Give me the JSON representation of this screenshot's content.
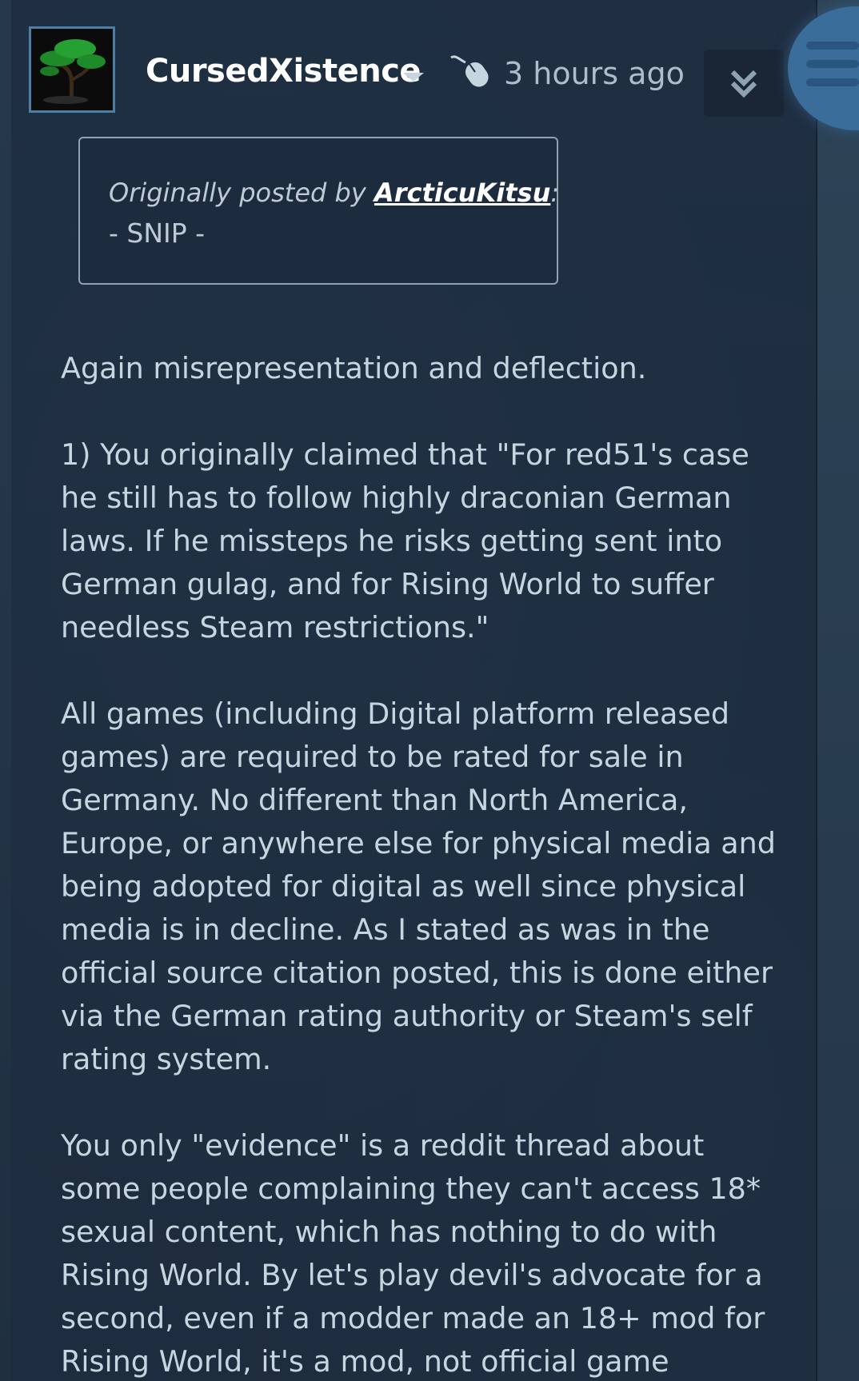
{
  "post": {
    "author": "CursedXistence",
    "timestamp": "3 hours ago",
    "quote": {
      "prefix": "Originally posted by",
      "author": "ArcticuKitsu",
      "suffix": ":",
      "text": "- SNIP -"
    },
    "paragraphs": [
      [
        "Again misrepresentation and deflection."
      ],
      [
        "1) You originally claimed that \"For red51's case",
        "he still has to follow highly draconian German",
        "laws. If he missteps he risks getting sent into",
        "German gulag, and for Rising World to suffer",
        "needless Steam restrictions.\""
      ],
      [
        "All games (including Digital platform released",
        "games) are required to be rated for sale in",
        "Germany. No different than North America,",
        "Europe, or anywhere else for physical media and",
        "being adopted for digital as well since physical",
        "media is in decline. As I stated as was in the",
        "official source citation posted, this is done either",
        "via the German rating authority or Steam's self",
        "rating system."
      ],
      [
        "You only \"evidence\" is a reddit thread about",
        "some people complaining they can't access 18*",
        "sexual content, which has nothing to do with",
        "Rising World. By let's play devil's advocate for a",
        "second, even if a modder made an 18+ mod for",
        "Rising World, it's a mod, not official game"
      ]
    ]
  },
  "icons": {
    "avatar": "bonsai-tree-avatar",
    "author_menu": "caret-down-icon",
    "device": "mouse-icon",
    "collapse": "double-chevron-down-icon",
    "menu": "hamburger-menu-icon"
  },
  "colors": {
    "background": "#1b2a3c",
    "text": "#c7d5e0",
    "author": "#ffffff",
    "menu_button": "#3b6d9b"
  }
}
